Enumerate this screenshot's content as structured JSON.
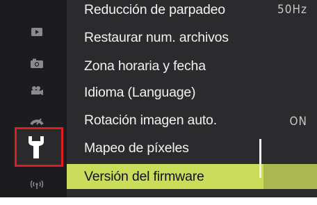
{
  "sidebar": {
    "icons": [
      {
        "name": "playback-icon"
      },
      {
        "name": "camera-icon"
      },
      {
        "name": "movie-icon"
      },
      {
        "name": "custom-settings-icon"
      },
      {
        "name": "wrench-icon",
        "selected": true
      },
      {
        "name": "wireless-icon"
      }
    ]
  },
  "menu": {
    "items": [
      {
        "label": "Reducción de parpadeo"
      },
      {
        "label": "Restaurar num. archivos"
      },
      {
        "label": "Zona horaria y fecha"
      },
      {
        "label": "Idioma (Language)"
      },
      {
        "label": "Rotación imagen auto."
      },
      {
        "label": "Mapeo de píxeles"
      },
      {
        "label": "Versión del firmware",
        "selected": true
      }
    ],
    "values": {
      "flicker_reduction": "50Hz",
      "auto_rotation": "ON"
    }
  },
  "colors": {
    "selection": "#c9dd5a",
    "highlight_border": "#e11b22",
    "background": "#2b2b2d"
  }
}
